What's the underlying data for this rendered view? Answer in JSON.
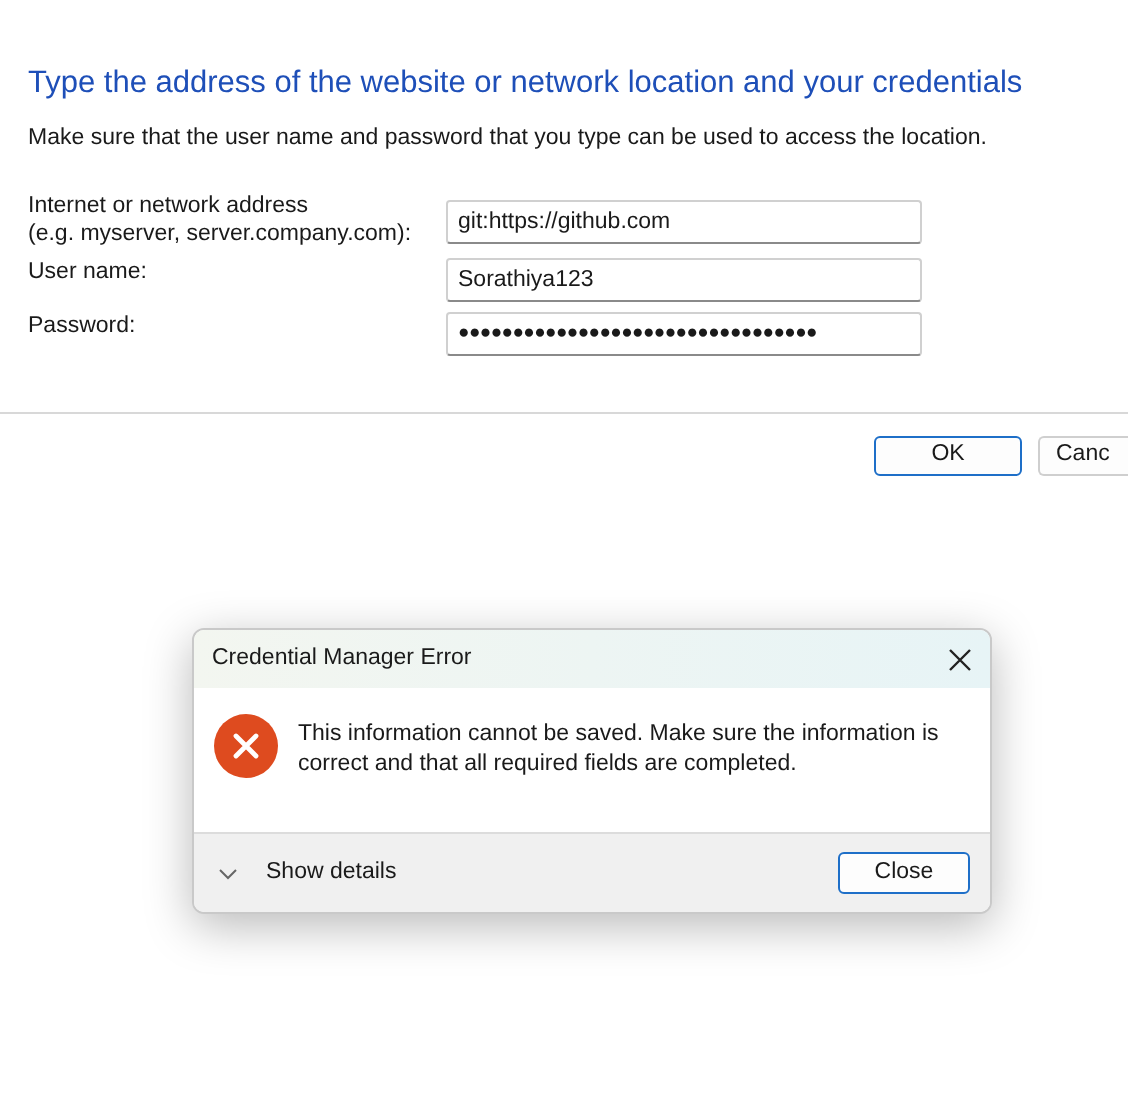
{
  "heading": "Type the address of the website or network location and your credentials",
  "instruction": "Make sure that the user name and password that you type can be used to access the location.",
  "fields": [
    {
      "label_lines": [
        "Internet or network address",
        "(e.g. myserver, server.company.com):"
      ],
      "value": "git:https://github.com"
    },
    {
      "label_lines": [
        "User name:"
      ],
      "value": "Sorathiya123"
    },
    {
      "label_lines": [
        "Password:"
      ],
      "value": "●●●●●●●●●●●●●●●●●●●●●●●●●●●●●●●●●"
    }
  ],
  "buttons": [
    {
      "label": "OK",
      "default": true
    },
    {
      "label": "Canc",
      "default": false
    }
  ],
  "error_dialog": {
    "title": "Credential Manager Error",
    "message": "This information cannot be saved. Make sure the information is correct and that all required fields are completed.",
    "details_toggle": "Show details",
    "expanded": false,
    "button": "Close"
  }
}
